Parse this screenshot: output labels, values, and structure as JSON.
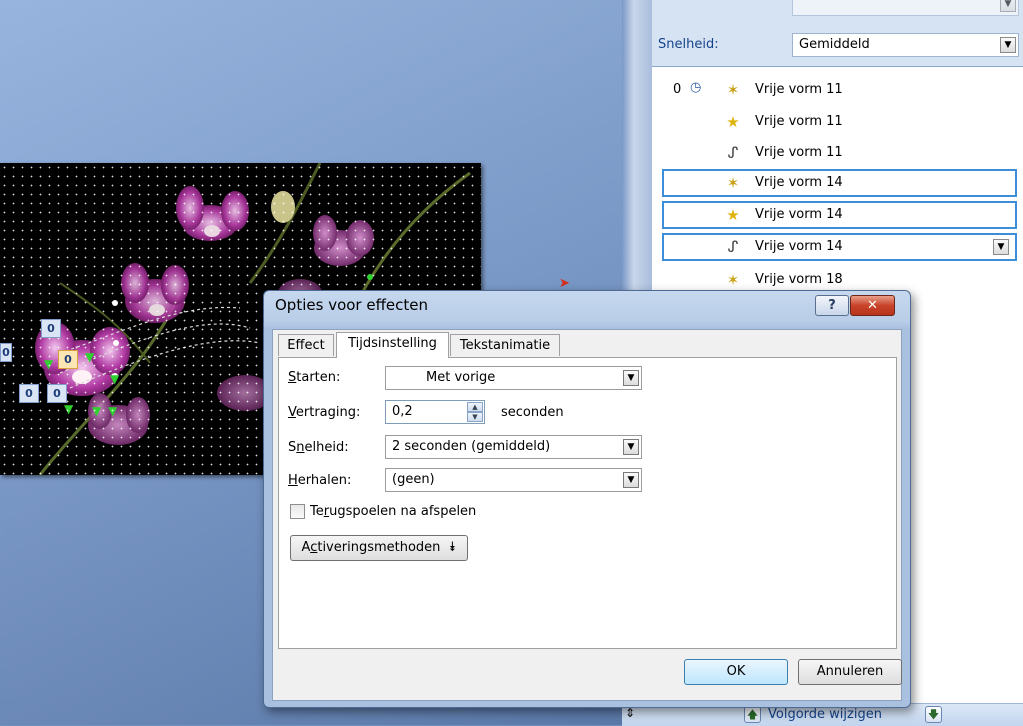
{
  "right_panel": {
    "speed_label": "Snelheid:",
    "speed_value": "Gemiddeld",
    "items": [
      {
        "num": "0",
        "name": "Vrije vorm 11",
        "icon": "entrance-effect-icon"
      },
      {
        "num": "",
        "name": "Vrije vorm 11",
        "icon": "emphasis-effect-icon"
      },
      {
        "num": "",
        "name": "Vrije vorm 11",
        "icon": "motion-path-icon"
      },
      {
        "num": "",
        "name": "Vrije vorm 14",
        "icon": "entrance-effect-icon"
      },
      {
        "num": "",
        "name": "Vrije vorm 14",
        "icon": "emphasis-effect-icon"
      },
      {
        "num": "",
        "name": "Vrije vorm 14",
        "icon": "motion-path-icon"
      },
      {
        "num": "",
        "name": "Vrije vorm 18",
        "icon": "entrance-effect-icon"
      }
    ],
    "reorder_label": "Volgorde wijzigen"
  },
  "slide": {
    "tags": [
      "0",
      "0",
      "0",
      "0",
      "0"
    ]
  },
  "dialog": {
    "title": "Opties voor effecten",
    "help": "?",
    "close": "✕",
    "tabs": [
      "Effect",
      "Tijdsinstelling",
      "Tekstanimatie"
    ],
    "start_label_u": "S",
    "start_label_rest": "tarten:",
    "start_value": "Met vorige",
    "delay_label_u": "V",
    "delay_label_rest": "ertraging:",
    "delay_value": "0,2",
    "delay_unit": "seconden",
    "speed_label_pre": "S",
    "speed_label_u": "n",
    "speed_label_rest": "elheid:",
    "speed_value": "2 seconden (gemiddeld)",
    "repeat_label_u": "H",
    "repeat_label_rest": "erhalen:",
    "repeat_value": "(geen)",
    "rewind_pre": "Te",
    "rewind_u": "r",
    "rewind_rest": "ugspoelen na afspelen",
    "triggers_pre": "A",
    "triggers_u": "c",
    "triggers_rest": "tiveringsmethoden",
    "ok": "OK",
    "cancel": "Annuleren"
  },
  "colors": {
    "accent": "#3c8ed8",
    "panel_bg": "#d6e3f3",
    "dialog_frame": "#b9cde8",
    "close_red": "#c7432a"
  }
}
